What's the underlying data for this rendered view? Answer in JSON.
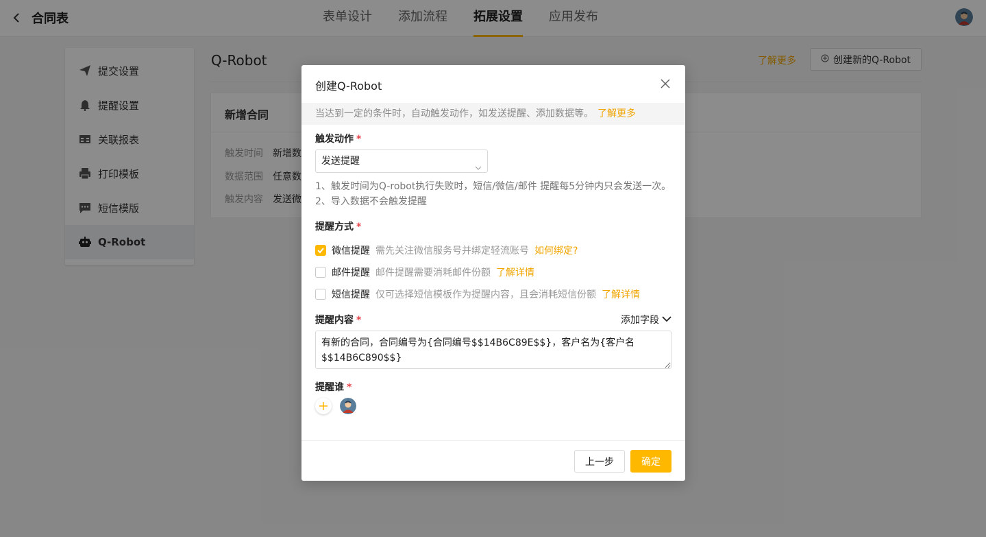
{
  "header": {
    "title": "合同表",
    "tabs": [
      {
        "label": "表单设计"
      },
      {
        "label": "添加流程"
      },
      {
        "label": "拓展设置"
      },
      {
        "label": "应用发布"
      }
    ],
    "active_tab": "拓展设置"
  },
  "sidebar": {
    "items": [
      {
        "label": "提交设置",
        "icon": "send-icon"
      },
      {
        "label": "提醒设置",
        "icon": "bell-icon"
      },
      {
        "label": "关联报表",
        "icon": "table-icon"
      },
      {
        "label": "打印模板",
        "icon": "printer-icon"
      },
      {
        "label": "短信模版",
        "icon": "message-icon"
      },
      {
        "label": "Q-Robot",
        "icon": "robot-icon"
      }
    ],
    "active": "Q-Robot"
  },
  "main": {
    "title": "Q-Robot",
    "learn_more": "了解更多",
    "create_button": "创建新的Q-Robot",
    "card": {
      "title": "新增合同",
      "rows": [
        {
          "label": "触发时间",
          "value": "新增数"
        },
        {
          "label": "数据范围",
          "value": "任意数"
        },
        {
          "label": "触发内容",
          "value": "发送微"
        }
      ]
    }
  },
  "modal": {
    "title": "创建Q-Robot",
    "tip": "当达到一定的条件时，自动触发动作，如发送提醒、添加数据等。",
    "tip_link": "了解更多",
    "trigger_action": {
      "label": "触发动作",
      "required": "*",
      "value": "发送提醒",
      "notes": [
        "1、触发时间为Q-robot执行失败时，短信/微信/邮件 提醒每5分钟内只会发送一次。",
        "2、导入数据不会触发提醒"
      ]
    },
    "remind_method": {
      "label": "提醒方式",
      "required": "*",
      "options": [
        {
          "name": "微信提醒",
          "desc": "需先关注微信服务号并绑定轻流账号",
          "link": "如何绑定?",
          "checked": true
        },
        {
          "name": "邮件提醒",
          "desc": "邮件提醒需要消耗邮件份额",
          "link": "了解详情",
          "checked": false
        },
        {
          "name": "短信提醒",
          "desc": "仅可选择短信模板作为提醒内容，且会消耗短信份额",
          "link": "了解详情",
          "checked": false
        }
      ]
    },
    "remind_content": {
      "label": "提醒内容",
      "required": "*",
      "add_field": "添加字段",
      "value": "有新的合同，合同编号为{合同编号$$14B6C89E$$}，客户名为{客户名$$14B6C890$$}"
    },
    "remind_who": {
      "label": "提醒谁",
      "required": "*"
    },
    "footer": {
      "prev": "上一步",
      "ok": "确定"
    }
  },
  "colors": {
    "accent": "#ffb800",
    "link": "#f0a500",
    "required": "#e5484d"
  }
}
